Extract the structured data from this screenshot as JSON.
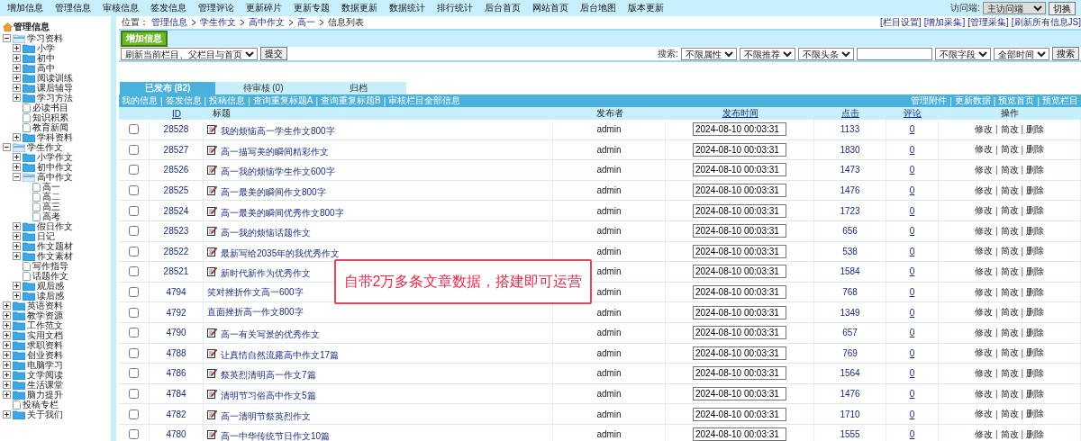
{
  "top_nav": {
    "items": [
      "增加信息",
      "管理信息",
      "审核信息",
      "签发信息",
      "管理评论",
      "更新碎片",
      "更新专题",
      "数据更新",
      "数据统计",
      "排行统计",
      "后台首页",
      "网站首页",
      "后台地图",
      "版本更新"
    ],
    "access_label": "访问端:",
    "access_select": "主访问端",
    "switch_button": "切换"
  },
  "sidebar": {
    "title": "管理信息",
    "items": [
      {
        "label": "学习资料",
        "kind": "folder",
        "expanded": true,
        "children": [
          {
            "label": "小学",
            "kind": "folder",
            "expanded": false
          },
          {
            "label": "初中",
            "kind": "folder",
            "expanded": false
          },
          {
            "label": "高中",
            "kind": "folder",
            "expanded": false
          },
          {
            "label": "阅读训练",
            "kind": "folder",
            "expanded": false
          },
          {
            "label": "课后辅导",
            "kind": "folder",
            "expanded": false
          },
          {
            "label": "学习方法",
            "kind": "folder",
            "expanded": false
          },
          {
            "label": "必读书目",
            "kind": "page"
          },
          {
            "label": "知识积累",
            "kind": "page"
          },
          {
            "label": "教育新闻",
            "kind": "page"
          },
          {
            "label": "学科资料",
            "kind": "folder",
            "expanded": false
          }
        ]
      },
      {
        "label": "学生作文",
        "kind": "folder",
        "expanded": true,
        "children": [
          {
            "label": "小学作文",
            "kind": "folder",
            "expanded": false
          },
          {
            "label": "初中作文",
            "kind": "folder",
            "expanded": false
          },
          {
            "label": "高中作文",
            "kind": "folder",
            "expanded": true,
            "children": [
              {
                "label": "高一",
                "kind": "page"
              },
              {
                "label": "高二",
                "kind": "page"
              },
              {
                "label": "高三",
                "kind": "page"
              },
              {
                "label": "高考",
                "kind": "page"
              }
            ]
          },
          {
            "label": "假日作文",
            "kind": "folder",
            "expanded": false
          },
          {
            "label": "日记",
            "kind": "folder",
            "expanded": false
          },
          {
            "label": "作文题材",
            "kind": "folder",
            "expanded": false
          },
          {
            "label": "作文素材",
            "kind": "folder",
            "expanded": false
          },
          {
            "label": "写作指导",
            "kind": "page"
          },
          {
            "label": "话题作文",
            "kind": "page"
          },
          {
            "label": "观后感",
            "kind": "folder",
            "expanded": false
          },
          {
            "label": "读后感",
            "kind": "folder",
            "expanded": false
          }
        ]
      },
      {
        "label": "英语资料",
        "kind": "folder",
        "expanded": false
      },
      {
        "label": "教学资源",
        "kind": "folder",
        "expanded": false
      },
      {
        "label": "工作范文",
        "kind": "folder",
        "expanded": false
      },
      {
        "label": "实用文档",
        "kind": "folder",
        "expanded": false
      },
      {
        "label": "求职资料",
        "kind": "folder",
        "expanded": false
      },
      {
        "label": "创业资料",
        "kind": "folder",
        "expanded": false
      },
      {
        "label": "电脑学习",
        "kind": "folder",
        "expanded": false
      },
      {
        "label": "文学阅读",
        "kind": "folder",
        "expanded": false
      },
      {
        "label": "生活课堂",
        "kind": "folder",
        "expanded": false
      },
      {
        "label": "脑力提升",
        "kind": "folder",
        "expanded": false
      },
      {
        "label": "投稿专栏",
        "kind": "page"
      },
      {
        "label": "关于我们",
        "kind": "folder",
        "expanded": false
      }
    ]
  },
  "breadcrumb": {
    "label": "位置：",
    "items": [
      "管理信息",
      "学生作文",
      "高中作文",
      "高一"
    ],
    "current": "信息列表"
  },
  "top_links": [
    "[栏目设置]",
    "[增加采集]",
    "[管理采集]",
    "[刷新所有信息JS]"
  ],
  "add_button": "增加信息",
  "refresh_select": "刷新当前栏目、父栏目与首页",
  "submit_button": "提交",
  "search": {
    "label": "搜索:",
    "filters": [
      "不限属性",
      "不限推荐",
      "不限头条"
    ],
    "field_select": "不限字段",
    "time_select": "全部时间",
    "button": "搜索"
  },
  "tabs": [
    {
      "label": "已发布 (82)",
      "selected": true
    },
    {
      "label": "待审核 (0)",
      "selected": false
    },
    {
      "label": "归档",
      "selected": false
    }
  ],
  "left_links": [
    "我的信息",
    "|",
    "签发信息",
    "|",
    "投稿信息",
    "|",
    "查询重复标题A",
    "|",
    "查询重复标题B",
    "|",
    "审核栏目全部信息"
  ],
  "right_links": [
    "管理附件",
    "|",
    "更新数据",
    "|",
    "预览首页",
    "|",
    "预览栏目"
  ],
  "table": {
    "columns": [
      "ID",
      "标题",
      "发布者",
      "发布时间",
      "点击",
      "评论",
      "操作"
    ],
    "rows": [
      {
        "checked": false,
        "id": "28528",
        "title": "我的烦恼高一学生作文800字",
        "has_icon": true,
        "publisher": "admin",
        "time": "2024-08-10 00:03:31",
        "clicks": "1133",
        "comments": "0",
        "actions": [
          "修改",
          "|",
          "简改",
          "|",
          "删除"
        ]
      },
      {
        "checked": false,
        "id": "28527",
        "title": "高一描写美的瞬间精彩作文",
        "has_icon": true,
        "publisher": "admin",
        "time": "2024-08-10 00:03:31",
        "clicks": "1830",
        "comments": "0",
        "actions": [
          "修改",
          "|",
          "简改",
          "|",
          "删除"
        ]
      },
      {
        "checked": false,
        "id": "28526",
        "title": "高一我的烦恼学生作文600字",
        "has_icon": true,
        "publisher": "admin",
        "time": "2024-08-10 00:03:31",
        "clicks": "1473",
        "comments": "0",
        "actions": [
          "修改",
          "|",
          "简改",
          "|",
          "删除"
        ]
      },
      {
        "checked": false,
        "id": "28525",
        "title": "高一最美的瞬间作文800字",
        "has_icon": true,
        "publisher": "admin",
        "time": "2024-08-10 00:03:31",
        "clicks": "1476",
        "comments": "0",
        "actions": [
          "修改",
          "|",
          "简改",
          "|",
          "删除"
        ]
      },
      {
        "checked": false,
        "id": "28524",
        "title": "高一最美的瞬间优秀作文800字",
        "has_icon": true,
        "publisher": "admin",
        "time": "2024-08-10 00:03:31",
        "clicks": "1723",
        "comments": "0",
        "actions": [
          "修改",
          "|",
          "简改",
          "|",
          "删除"
        ]
      },
      {
        "checked": false,
        "id": "28523",
        "title": "高一我的烦恼话题作文",
        "has_icon": true,
        "publisher": "admin",
        "time": "2024-08-10 00:03:31",
        "clicks": "656",
        "comments": "0",
        "actions": [
          "修改",
          "|",
          "简改",
          "|",
          "删除"
        ]
      },
      {
        "checked": false,
        "id": "28522",
        "title": "最新写给2035年的我优秀作文",
        "has_icon": true,
        "publisher": "admin",
        "time": "2024-08-10 00:03:31",
        "clicks": "538",
        "comments": "0",
        "actions": [
          "修改",
          "|",
          "简改",
          "|",
          "删除"
        ]
      },
      {
        "checked": false,
        "id": "28521",
        "title": "新时代新作为优秀作文",
        "has_icon": true,
        "publisher": "admin",
        "time": "2024-08-10 00:03:31",
        "clicks": "1584",
        "comments": "0",
        "actions": [
          "修改",
          "|",
          "简改",
          "|",
          "删除"
        ]
      },
      {
        "checked": false,
        "id": "4794",
        "title": "笑对挫折作文高一600字",
        "has_icon": false,
        "publisher": "admin",
        "time": "2024-08-10 00:03:31",
        "clicks": "768",
        "comments": "0",
        "actions": [
          "修改",
          "|",
          "简改",
          "|",
          "删除"
        ]
      },
      {
        "checked": false,
        "id": "4792",
        "title": "直面挫折高一作文800字",
        "has_icon": false,
        "publisher": "admin",
        "time": "2024-08-10 00:03:31",
        "clicks": "1349",
        "comments": "0",
        "actions": [
          "修改",
          "|",
          "简改",
          "|",
          "删除"
        ]
      },
      {
        "checked": false,
        "id": "4790",
        "title": "高一有关写景的优秀作文",
        "has_icon": true,
        "publisher": "admin",
        "time": "2024-08-10 00:03:31",
        "clicks": "657",
        "comments": "0",
        "actions": [
          "修改",
          "|",
          "简改",
          "|",
          "删除"
        ]
      },
      {
        "checked": false,
        "id": "4788",
        "title": "让真情自然流露高中作文17篇",
        "has_icon": true,
        "publisher": "admin",
        "time": "2024-08-10 00:03:31",
        "clicks": "769",
        "comments": "0",
        "actions": [
          "修改",
          "|",
          "简改",
          "|",
          "删除"
        ]
      },
      {
        "checked": false,
        "id": "4786",
        "title": "祭英烈清明高一作文7篇",
        "has_icon": true,
        "publisher": "admin",
        "time": "2024-08-10 00:03:31",
        "clicks": "1564",
        "comments": "0",
        "actions": [
          "修改",
          "|",
          "简改",
          "|",
          "删除"
        ]
      },
      {
        "checked": false,
        "id": "4784",
        "title": "清明节习俗高中作文5篇",
        "has_icon": true,
        "publisher": "admin",
        "time": "2024-08-10 00:03:31",
        "clicks": "1476",
        "comments": "0",
        "actions": [
          "修改",
          "|",
          "简改",
          "|",
          "删除"
        ]
      },
      {
        "checked": false,
        "id": "4782",
        "title": "高一清明节祭英烈作文",
        "has_icon": true,
        "publisher": "admin",
        "time": "2024-08-10 00:03:31",
        "clicks": "1710",
        "comments": "0",
        "actions": [
          "修改",
          "|",
          "简改",
          "|",
          "删除"
        ]
      },
      {
        "checked": false,
        "id": "4780",
        "title": "高一中华传统节日作文10篇",
        "has_icon": true,
        "publisher": "admin",
        "time": "2024-08-10 00:03:31",
        "clicks": "1555",
        "comments": "0",
        "actions": [
          "修改",
          "|",
          "简改",
          "|",
          "删除"
        ]
      }
    ]
  },
  "promo_banner": "自带2万多条文章数据，搭建即可运营"
}
